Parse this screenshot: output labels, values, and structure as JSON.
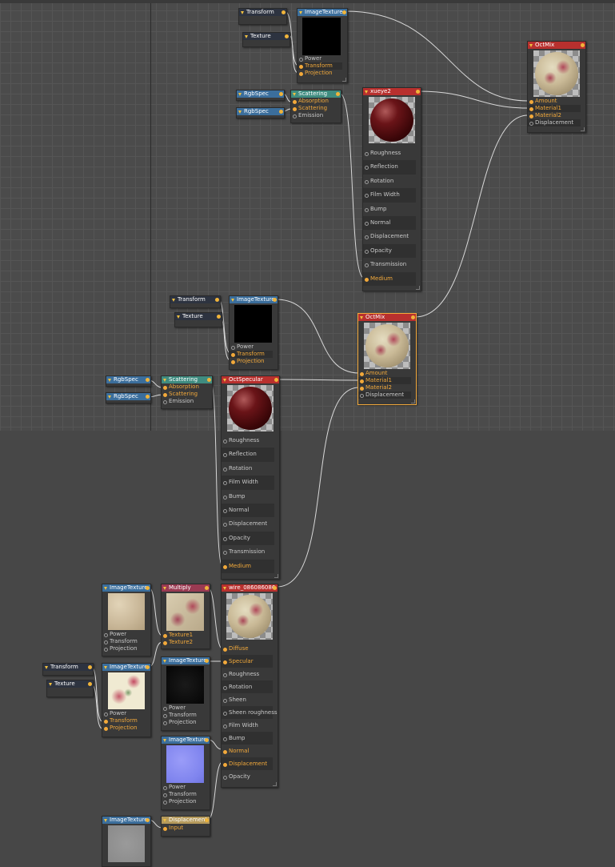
{
  "colors": {
    "wire": "#d8d8d8",
    "pin_active": "#f2a93b",
    "header_red": "#b8302e",
    "header_blue": "#3b6e9c",
    "header_teal": "#3f8c80"
  },
  "nodes": {
    "t1_transform": {
      "title": "Transform"
    },
    "t1_texture": {
      "title": "Texture"
    },
    "t1_imgtex": {
      "title": "ImageTexture",
      "pins": [
        "Power",
        "Transform",
        "Projection"
      ]
    },
    "t1_rgb1": {
      "title": "RgbSpec"
    },
    "t1_rgb2": {
      "title": "RgbSpec"
    },
    "t1_scatter": {
      "title": "Scattering",
      "pins": [
        "Absorption",
        "Scattering",
        "Emission"
      ]
    },
    "xueye2": {
      "title": "xueye2",
      "pins": [
        "Roughness",
        "Reflection",
        "Rotation",
        "Film Width",
        "Bump",
        "Normal",
        "Displacement",
        "Opacity",
        "Transmission",
        "Medium"
      ]
    },
    "octmix_top": {
      "title": "OctMix",
      "pins": [
        "Amount",
        "Material1",
        "Material2",
        "Displacement"
      ]
    },
    "t2_transform": {
      "title": "Transform"
    },
    "t2_texture": {
      "title": "Texture"
    },
    "t2_imgtex": {
      "title": "ImageTexture",
      "pins": [
        "Power",
        "Transform",
        "Projection"
      ]
    },
    "t2_rgb1": {
      "title": "RgbSpec"
    },
    "t2_rgb2": {
      "title": "RgbSpec"
    },
    "t2_scatter": {
      "title": "Scattering",
      "pins": [
        "Absorption",
        "Scattering",
        "Emission"
      ]
    },
    "octspecular": {
      "title": "OctSpecular",
      "pins": [
        "Roughness",
        "Reflection",
        "Rotation",
        "Film Width",
        "Bump",
        "Normal",
        "Displacement",
        "Opacity",
        "Transmission",
        "Medium"
      ]
    },
    "octmix_mid": {
      "title": "OctMix",
      "pins": [
        "Amount",
        "Material1",
        "Material2",
        "Displacement"
      ]
    },
    "b_imgtex1": {
      "title": "ImageTexture",
      "pins": [
        "Power",
        "Transform",
        "Projection"
      ]
    },
    "multiply": {
      "title": "Multiply",
      "pins": [
        "Texture1",
        "Texture2"
      ]
    },
    "wire": {
      "title": "wire_086086086",
      "pins": [
        "Diffuse",
        "Specular",
        "Roughness",
        "Rotation",
        "Sheen",
        "Sheen roughness",
        "Film Width",
        "Bump",
        "Normal",
        "Displacement",
        "Opacity"
      ]
    },
    "b_transform": {
      "title": "Transform"
    },
    "b_texture": {
      "title": "Texture"
    },
    "b_imgtex2": {
      "title": "ImageTexture",
      "pins": [
        "Power",
        "Transform",
        "Projection"
      ]
    },
    "b_imgtex3": {
      "title": "ImageTexture",
      "pins": [
        "Power",
        "Transform",
        "Projection"
      ]
    },
    "b_imgtex4": {
      "title": "ImageTexture",
      "pins": [
        "Power",
        "Transform",
        "Projection"
      ]
    },
    "b_imgtex5": {
      "title": "ImageTexture"
    },
    "b_displacement": {
      "title": "Displacement",
      "pins": [
        "Input"
      ]
    }
  }
}
